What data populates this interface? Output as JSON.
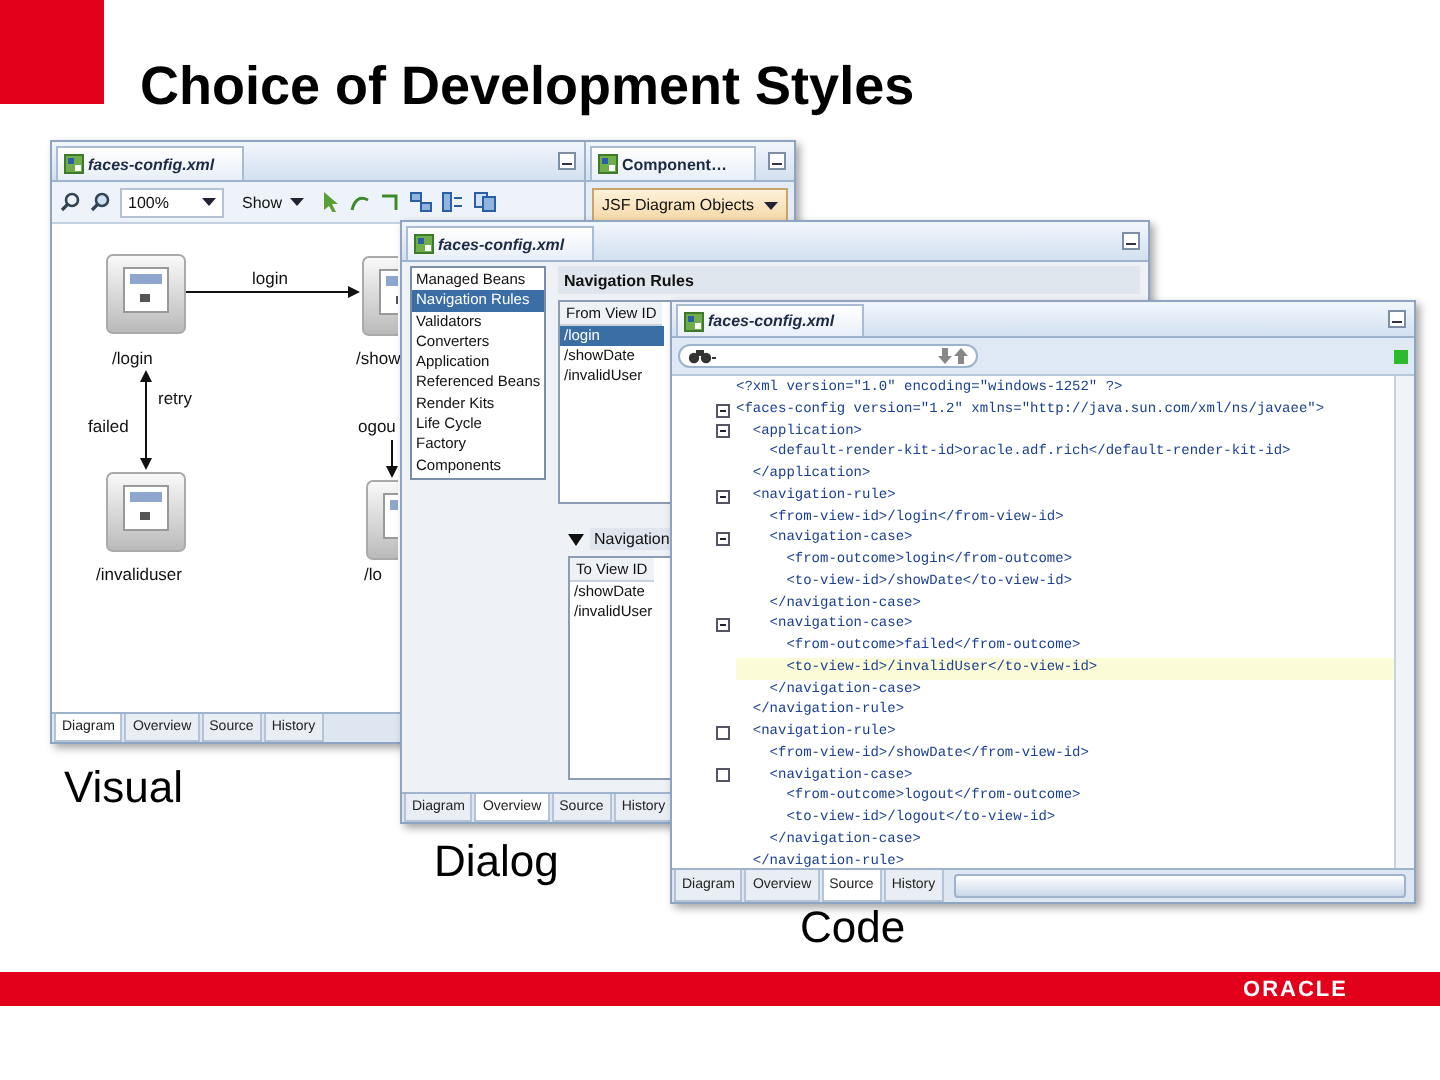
{
  "slide": {
    "title": "Choice of Development Styles"
  },
  "visual_window": {
    "tab_title": "faces-config.xml",
    "toolbar": {
      "zoom": "100%",
      "show": "Show"
    },
    "diagram": {
      "nodes": [
        {
          "label": "/login"
        },
        {
          "label": "/show"
        },
        {
          "label": "/invaliduser"
        },
        {
          "label": "/lo"
        }
      ],
      "edge_labels": [
        "login",
        "retry",
        "failed",
        "ogou"
      ]
    },
    "bottom_tabs": [
      {
        "label": "Diagram",
        "selected": true
      },
      {
        "label": "Overview",
        "selected": false
      },
      {
        "label": "Source",
        "selected": false
      },
      {
        "label": "History",
        "selected": false
      }
    ],
    "component_panel": {
      "title": "Component…",
      "dropdown": "JSF Diagram Objects"
    }
  },
  "dialog_window": {
    "tab_title": "faces-config.xml",
    "categories": [
      {
        "label": "Managed Beans",
        "selected": false
      },
      {
        "label": "Navigation Rules",
        "selected": true
      },
      {
        "label": "Validators",
        "selected": false
      },
      {
        "label": "Converters",
        "selected": false
      },
      {
        "label": "Application",
        "selected": false
      },
      {
        "label": "Referenced Beans",
        "selected": false
      },
      {
        "label": "Render Kits",
        "selected": false
      },
      {
        "label": "Life Cycle",
        "selected": false
      },
      {
        "label": "Factory",
        "selected": false
      },
      {
        "label": "Components",
        "selected": false
      }
    ],
    "rules_title": "Navigation Rules",
    "rules_column": "From View ID",
    "rules": [
      {
        "label": "/login",
        "selected": true
      },
      {
        "label": "/showDate",
        "selected": false
      },
      {
        "label": "/invalidUser",
        "selected": false
      }
    ],
    "cases_title": "Navigation",
    "cases_column": "To View ID",
    "cases": [
      {
        "label": "/showDate"
      },
      {
        "label": "/invalidUser"
      }
    ],
    "bottom_tabs": [
      {
        "label": "Diagram",
        "selected": false
      },
      {
        "label": "Overview",
        "selected": true
      },
      {
        "label": "Source",
        "selected": false
      },
      {
        "label": "History",
        "selected": false
      }
    ]
  },
  "code_window": {
    "tab_title": "faces-config.xml",
    "lines": [
      {
        "text": "<?xml version=\"1.0\" encoding=\"windows-1252\" ?>",
        "kind": "plain",
        "highlighted": false
      },
      {
        "text": "<faces-config version=\"1.2\" xmlns=\"http://java.sun.com/xml/ns/javaee\">",
        "kind": "expanded",
        "highlighted": false
      },
      {
        "text": "  <application>",
        "kind": "expanded",
        "highlighted": false
      },
      {
        "text": "    <default-render-kit-id>oracle.adf.rich</default-render-kit-id>",
        "kind": "plain",
        "highlighted": false
      },
      {
        "text": "  </application>",
        "kind": "plain",
        "highlighted": false
      },
      {
        "text": "  <navigation-rule>",
        "kind": "expanded",
        "highlighted": false
      },
      {
        "text": "    <from-view-id>/login</from-view-id>",
        "kind": "plain",
        "highlighted": false
      },
      {
        "text": "    <navigation-case>",
        "kind": "expanded",
        "highlighted": false
      },
      {
        "text": "      <from-outcome>login</from-outcome>",
        "kind": "plain",
        "highlighted": false
      },
      {
        "text": "      <to-view-id>/showDate</to-view-id>",
        "kind": "plain",
        "highlighted": false
      },
      {
        "text": "    </navigation-case>",
        "kind": "plain",
        "highlighted": false
      },
      {
        "text": "    <navigation-case>",
        "kind": "expanded",
        "highlighted": false
      },
      {
        "text": "      <from-outcome>failed</from-outcome>",
        "kind": "plain",
        "highlighted": false
      },
      {
        "text": "      <to-view-id>/invalidUser</to-view-id>",
        "kind": "plain",
        "highlighted": true
      },
      {
        "text": "    </navigation-case>",
        "kind": "plain",
        "highlighted": false
      },
      {
        "text": "  </navigation-rule>",
        "kind": "plain",
        "highlighted": false
      },
      {
        "text": "  <navigation-rule>",
        "kind": "foldable",
        "highlighted": false
      },
      {
        "text": "    <from-view-id>/showDate</from-view-id>",
        "kind": "plain",
        "highlighted": false
      },
      {
        "text": "    <navigation-case>",
        "kind": "foldable",
        "highlighted": false
      },
      {
        "text": "      <from-outcome>logout</from-outcome>",
        "kind": "plain",
        "highlighted": false
      },
      {
        "text": "      <to-view-id>/logout</to-view-id>",
        "kind": "plain",
        "highlighted": false
      },
      {
        "text": "    </navigation-case>",
        "kind": "plain",
        "highlighted": false
      },
      {
        "text": "  </navigation-rule>",
        "kind": "plain",
        "highlighted": false
      }
    ],
    "bottom_tabs": [
      {
        "label": "Diagram",
        "selected": false
      },
      {
        "label": "Overview",
        "selected": false
      },
      {
        "label": "Source",
        "selected": true
      },
      {
        "label": "History",
        "selected": false
      }
    ]
  },
  "captions": [
    "Visual",
    "Dialog",
    "Code"
  ],
  "footer": {
    "logo": "ORACLE"
  }
}
